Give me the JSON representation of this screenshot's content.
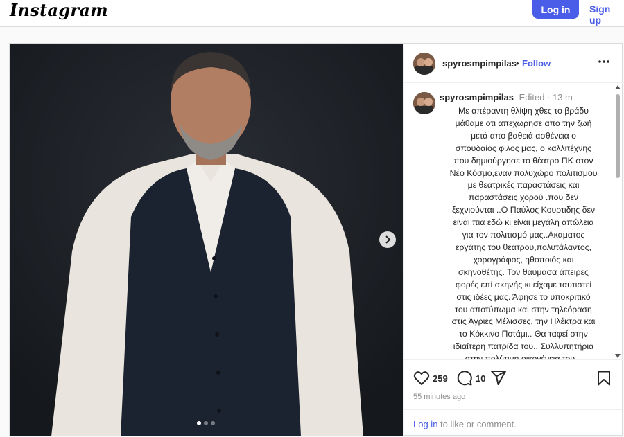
{
  "topbar": {
    "logo": "Instagram",
    "login_label": "Log in",
    "signup_label": "Sign up"
  },
  "post": {
    "username": "spyrosmpimpilas",
    "separator": "•",
    "follow_label": "Follow",
    "caption": {
      "username": "spyrosmpimpilas",
      "meta": "Edited · 13 m",
      "text": "Με απέραντη θλίψη χθες το βράδυ\nμάθαμε οτι απεχωρησε απο την ζωή\nμετά απο βαθειά ασθένεια ο\nσπουδαίος φίλος μας, ο καλλιτέχνης\nπου δημιούργησε το θέατρο ΠΚ στον\nΝέο Κόσμο,εναν πολυχώρο πολιτισμου\nμε θεατρικές παραστάσεις  και\nπαραστάσεις χορού .που δεν\nξεχνιούνται ..Ο Παύλος Κουρτιδης δεν\nειναι πια εδώ κι είναι μεγάλη απώλεια\nγια τον πολιτισμό μας..Ακαματος\nεργάτης του θεατρου,πολυτάλαντος,\nχορογράφος, ηθοποιός και\nσκηνοθέτης. Τον θαυμασα άπειρες\nφορές επί σκηνής κι είχαμε ταυτιστεί\nστις ιδέες μας. Άφησε το υποκριτικό\nτου αποτύπωμα και στην τηλεόραση\nστις Άγριες Μέλισσες, την Ηλέκτρα και\nτο Κόκκινο Ποτάμι.. Θα ταφεί στην\nιδιαίτερη πατρίδα του.. Συλλυπητήρια\nστην πολύτιμη  οικογένεια του ..\nΠαύλο Καλέ μου φίλε θα μας λείπεις..."
    },
    "likes": "259",
    "comments": "10",
    "time_ago": "55 minutes ago",
    "login_prompt": {
      "link": "Log in",
      "rest": " to like or comment."
    },
    "carousel": {
      "total": 3,
      "active": 1
    }
  },
  "colors": {
    "accent": "#4a5de8",
    "secondary_text": "#8e8e8e",
    "photo_bg": "#1c1f24"
  },
  "icons": [
    "more-options-icon",
    "heart-icon",
    "comment-icon",
    "share-icon",
    "bookmark-icon",
    "chevron-right-icon"
  ]
}
